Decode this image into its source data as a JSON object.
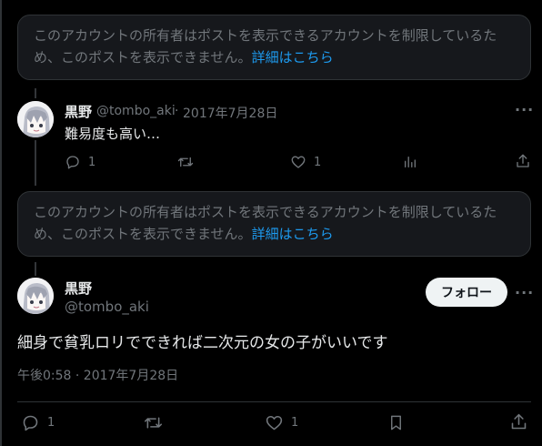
{
  "notice_1": {
    "text": "このアカウントの所有者はポストを表示できるアカウントを制限しているため、このポストを表示できません。",
    "link": "詳細はこちら"
  },
  "reply": {
    "display_name": "黒野",
    "handle": "@tombo_aki",
    "separator": "·",
    "date": "2017年7月28日",
    "text": "難易度も高い…",
    "reply_count": "1",
    "like_count": "1",
    "more": "···"
  },
  "notice_2": {
    "text": "このアカウントの所有者はポストを表示できるアカウントを制限しているため、このポストを表示できません。",
    "link": "詳細はこちら"
  },
  "main_post": {
    "display_name": "黒野",
    "handle": "@tombo_aki",
    "follow_label": "フォロー",
    "more": "···",
    "text": "細身で貧乳ロリでできれば二次元の女の子がいいです",
    "timestamp": "午後0:58 · 2017年7月28日",
    "reply_count": "1",
    "like_count": "1"
  },
  "colors": {
    "background": "#000000",
    "text": "#e7e9ea",
    "muted": "#71767b",
    "link": "#1d9bf0",
    "card": "#16181c",
    "border": "#2f3336"
  },
  "icons": [
    "reply-icon",
    "repost-icon",
    "like-icon",
    "views-icon",
    "share-icon",
    "bookmark-icon",
    "more-icon"
  ]
}
